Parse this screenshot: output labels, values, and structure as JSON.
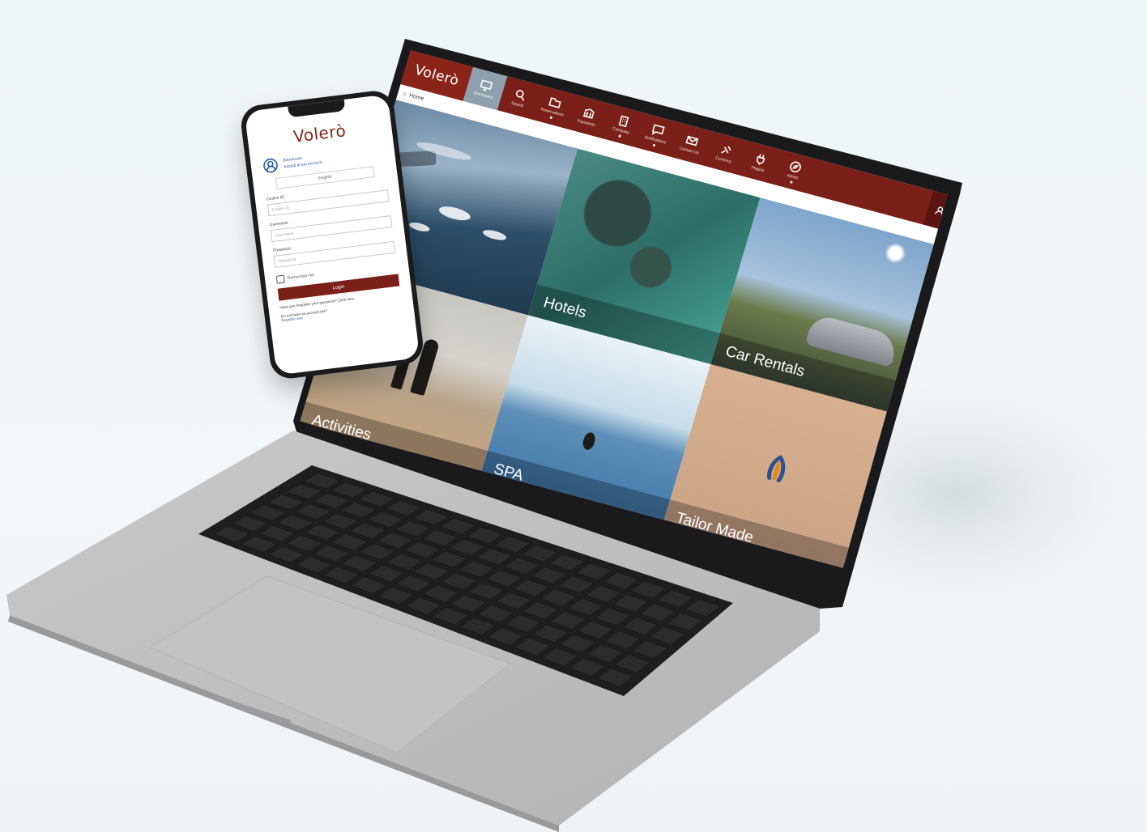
{
  "app": {
    "brand": "Volerò",
    "breadcrumb": "Home"
  },
  "nav": {
    "items": [
      {
        "label": "Dashboard",
        "icon": "monitor-icon"
      },
      {
        "label": "Search",
        "icon": "search-icon"
      },
      {
        "label": "Reservations",
        "icon": "folder-icon"
      },
      {
        "label": "Payments",
        "icon": "bank-icon"
      },
      {
        "label": "Company",
        "icon": "building-icon"
      },
      {
        "label": "Notifications",
        "icon": "chat-icon"
      },
      {
        "label": "Contact Us",
        "icon": "mail-icon"
      },
      {
        "label": "Currency",
        "icon": "satellite-icon"
      },
      {
        "label": "Plugins",
        "icon": "plug-icon"
      },
      {
        "label": "Admin",
        "icon": "compass-icon"
      }
    ]
  },
  "tiles": [
    {
      "label": ""
    },
    {
      "label": "Hotels"
    },
    {
      "label": "Car Rentals"
    },
    {
      "label": "Activities"
    },
    {
      "label": "SPA"
    },
    {
      "label": "Tailor Made"
    }
  ],
  "phone": {
    "brand": "Volerò",
    "user_line1": "Benvenuto",
    "user_line2": "Accedi al tuo account",
    "language": "English",
    "field1_label": "Codice ID",
    "field1_placeholder": "Codice ID",
    "field2_label": "Username",
    "field2_placeholder": "Username",
    "field3_label": "Password",
    "field3_placeholder": "Password",
    "remember_label": "Remember me",
    "login_button": "Login",
    "forgot_text": "Have you forgotten your password? Click here",
    "register_text": "Do not have an account yet?",
    "register_link": "Register now"
  }
}
